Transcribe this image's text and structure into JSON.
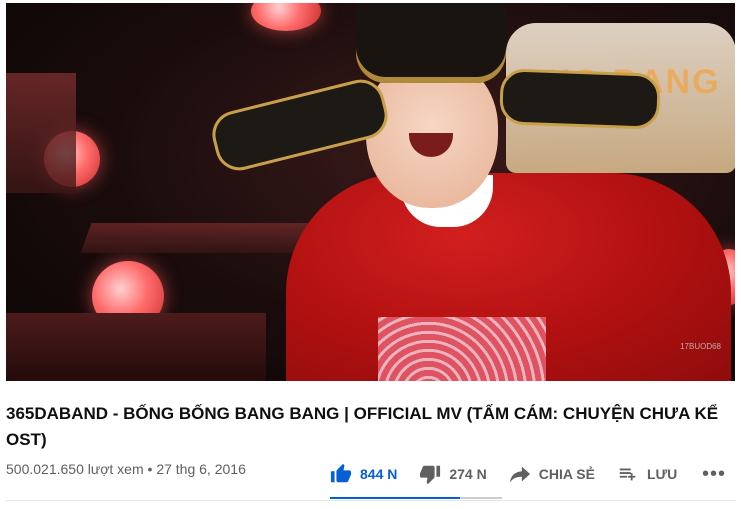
{
  "video": {
    "sign_text": "NG BANG",
    "watermark": "17BUOD68"
  },
  "title": "365DABAND - BỐNG BỐNG BANG BANG | OFFICIAL MV (TẤM CÁM: CHUYỆN CHƯA KỂ OST)",
  "views": "500.021.650 lượt xem",
  "separator": "•",
  "date": "27 thg 6, 2016",
  "actions": {
    "like_count": "844 N",
    "dislike_count": "274 N",
    "share_label": "CHIA SẺ",
    "save_label": "LƯU",
    "more_label": "•••"
  },
  "like_ratio": 0.755,
  "colors": {
    "accent": "#065fd4",
    "meta_text": "#606060"
  },
  "icons": {
    "like": "thumb-up-icon",
    "dislike": "thumb-down-icon",
    "share": "share-arrow-icon",
    "save": "playlist-add-icon",
    "more": "more-horiz-icon"
  }
}
